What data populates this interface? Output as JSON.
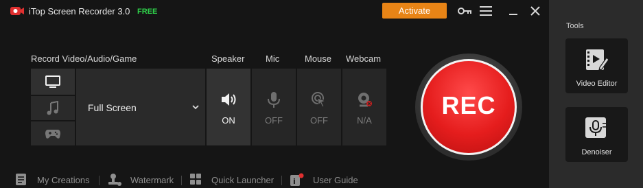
{
  "app": {
    "title": "iTop Screen Recorder 3.0",
    "badge": "FREE",
    "activate_label": "Activate"
  },
  "labels": {
    "record": "Record Video/Audio/Game",
    "speaker": "Speaker",
    "mic": "Mic",
    "mouse": "Mouse",
    "webcam": "Webcam"
  },
  "modes": [
    "monitor-icon",
    "music-note-icon",
    "gamepad-icon"
  ],
  "area": {
    "selected": "Full Screen"
  },
  "devices": {
    "speaker": "ON",
    "mic": "OFF",
    "mouse": "OFF",
    "webcam": "N/A"
  },
  "rec_label": "REC",
  "bottom": {
    "creations": "My Creations",
    "watermark": "Watermark",
    "launcher": "Quick Launcher",
    "guide": "User Guide"
  },
  "tools": {
    "title": "Tools",
    "video_editor": "Video Editor",
    "denoiser": "Denoiser"
  },
  "colors": {
    "accent_orange": "#e88416",
    "free_green": "#2fd14a",
    "rec_red": "#e51d1d"
  }
}
